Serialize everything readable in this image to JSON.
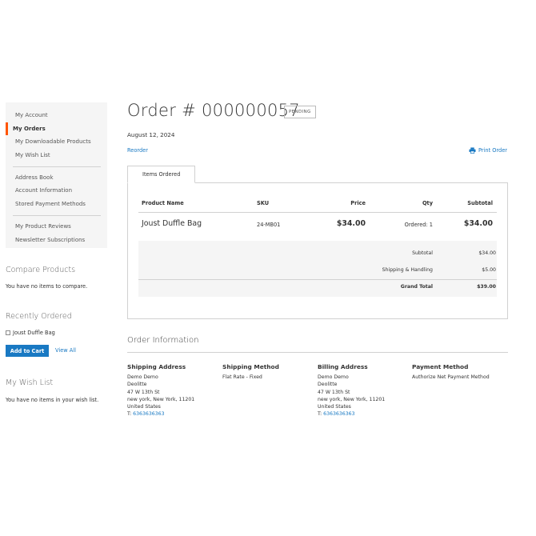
{
  "sidebar": {
    "nav_group1": [
      {
        "label": "My Account",
        "current": false
      },
      {
        "label": "My Orders",
        "current": true
      },
      {
        "label": "My Downloadable Products",
        "current": false
      },
      {
        "label": "My Wish List",
        "current": false
      }
    ],
    "nav_group2": [
      {
        "label": "Address Book"
      },
      {
        "label": "Account Information"
      },
      {
        "label": "Stored Payment Methods"
      }
    ],
    "nav_group3": [
      {
        "label": "My Product Reviews"
      },
      {
        "label": "Newsletter Subscriptions"
      }
    ],
    "compare": {
      "title": "Compare Products",
      "empty_text": "You have no items to compare."
    },
    "recent": {
      "title": "Recently Ordered",
      "item": "Joust Duffle Bag",
      "add_to_cart": "Add to Cart",
      "view_all": "View All"
    },
    "wishlist": {
      "title": "My Wish List",
      "empty_text": "You have no items in your wish list."
    }
  },
  "order": {
    "title": "Order # 000000057",
    "status": "PENDING",
    "date": "August 12, 2024",
    "reorder": "Reorder",
    "print": "Print Order",
    "tab": "Items Ordered"
  },
  "items_table": {
    "headers": {
      "product": "Product Name",
      "sku": "SKU",
      "price": "Price",
      "qty": "Qty",
      "subtotal": "Subtotal"
    },
    "rows": [
      {
        "product": "Joust Duffle Bag",
        "sku": "24-MB01",
        "price": "$34.00",
        "qty": "Ordered: 1",
        "subtotal": "$34.00"
      }
    ],
    "totals": {
      "subtotal_label": "Subtotal",
      "subtotal": "$34.00",
      "shipping_label": "Shipping & Handling",
      "shipping": "$5.00",
      "grand_label": "Grand Total",
      "grand": "$39.00"
    }
  },
  "order_info": {
    "title": "Order Information",
    "shipping_address": {
      "heading": "Shipping Address",
      "name": "Demo Demo",
      "company": "Deolitte",
      "street": "47 W 13th St",
      "city": "new york, New York, 11201",
      "country": "United States",
      "phone_prefix": "T:",
      "phone": "6363636363"
    },
    "shipping_method": {
      "heading": "Shipping Method",
      "value": "Flat Rate - Fixed"
    },
    "billing_address": {
      "heading": "Billing Address",
      "name": "Demo Demo",
      "company": "Deolitte",
      "street": "47 W 13th St",
      "city": "new york, New York, 11201",
      "country": "United States",
      "phone_prefix": "T:",
      "phone": "6363636363"
    },
    "payment_method": {
      "heading": "Payment Method",
      "value": "Authorize Net Payment Method"
    }
  },
  "colors": {
    "accent": "#ff5501",
    "link": "#1979c3",
    "sidebar_bg": "#f5f5f5"
  },
  "icons": {
    "print": "printer-icon"
  }
}
